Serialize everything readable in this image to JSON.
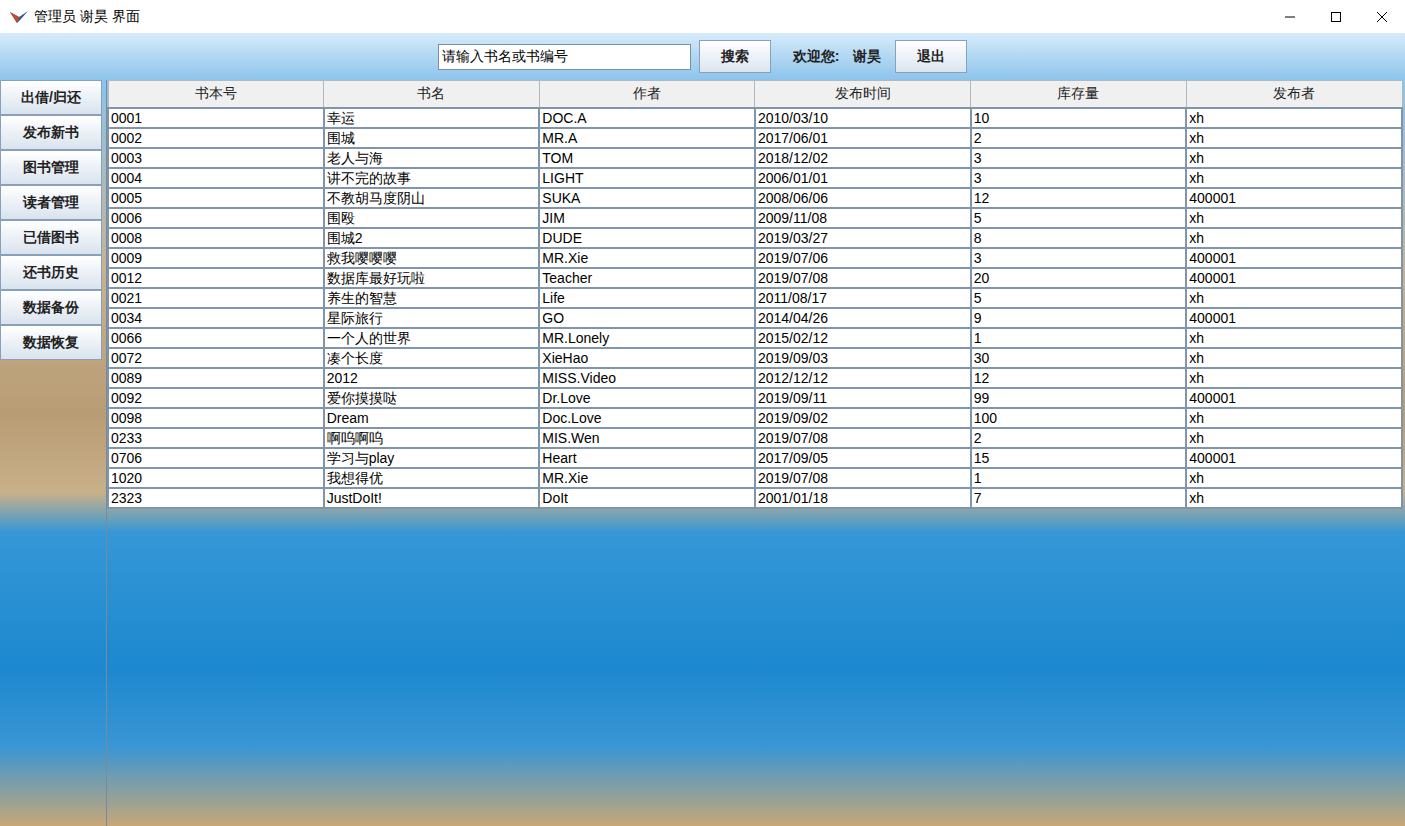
{
  "window": {
    "title": "管理员 谢昊 界面"
  },
  "search": {
    "value": "请输入书名或书编号"
  },
  "search_button": "搜索",
  "welcome": {
    "label": "欢迎您:",
    "user": "谢昊"
  },
  "logout_button": "退出",
  "sidebar": {
    "items": [
      {
        "label": "出借/归还"
      },
      {
        "label": "发布新书"
      },
      {
        "label": "图书管理"
      },
      {
        "label": "读者管理"
      },
      {
        "label": "已借图书"
      },
      {
        "label": "还书历史"
      },
      {
        "label": "数据备份"
      },
      {
        "label": "数据恢复"
      }
    ]
  },
  "table": {
    "columns": [
      "书本号",
      "书名",
      "作者",
      "发布时间",
      "库存量",
      "发布者"
    ],
    "rows": [
      [
        "0001",
        "幸运",
        "DOC.A",
        "2010/03/10",
        "10",
        "xh"
      ],
      [
        "0002",
        "围城",
        "MR.A",
        "2017/06/01",
        "2",
        "xh"
      ],
      [
        "0003",
        "老人与海",
        "TOM",
        "2018/12/02",
        "3",
        "xh"
      ],
      [
        "0004",
        "讲不完的故事",
        "LIGHT",
        "2006/01/01",
        "3",
        "xh"
      ],
      [
        "0005",
        "不教胡马度阴山",
        "SUKA",
        "2008/06/06",
        "12",
        "400001"
      ],
      [
        "0006",
        "围殴",
        "JIM",
        "2009/11/08",
        "5",
        "xh"
      ],
      [
        "0008",
        "围城2",
        "DUDE",
        "2019/03/27",
        "8",
        "xh"
      ],
      [
        "0009",
        "救我嘤嘤嘤",
        "MR.Xie",
        "2019/07/06",
        "3",
        "400001"
      ],
      [
        "0012",
        "数据库最好玩啦",
        "Teacher",
        "2019/07/08",
        "20",
        "400001"
      ],
      [
        "0021",
        "养生的智慧",
        "Life",
        "2011/08/17",
        "5",
        "xh"
      ],
      [
        "0034",
        "星际旅行",
        "GO",
        "2014/04/26",
        "9",
        "400001"
      ],
      [
        "0066",
        "一个人的世界",
        "MR.Lonely",
        "2015/02/12",
        "1",
        "xh"
      ],
      [
        "0072",
        "凑个长度",
        "XieHao",
        "2019/09/03",
        "30",
        "xh"
      ],
      [
        "0089",
        "2012",
        "MISS.Video",
        "2012/12/12",
        "12",
        "xh"
      ],
      [
        "0092",
        "爱你摸摸哒",
        "Dr.Love",
        "2019/09/11",
        "99",
        "400001"
      ],
      [
        "0098",
        "Dream",
        "Doc.Love",
        "2019/09/02",
        "100",
        "xh"
      ],
      [
        "0233",
        "啊呜啊呜",
        "MIS.Wen",
        "2019/07/08",
        "2",
        "xh"
      ],
      [
        "0706",
        "学习与play",
        "Heart",
        "2017/09/05",
        "15",
        "400001"
      ],
      [
        "1020",
        "我想得优",
        "MR.Xie",
        "2019/07/08",
        "1",
        "xh"
      ],
      [
        "2323",
        "JustDoIt!",
        "DoIt",
        "2001/01/18",
        "7",
        "xh"
      ]
    ]
  }
}
